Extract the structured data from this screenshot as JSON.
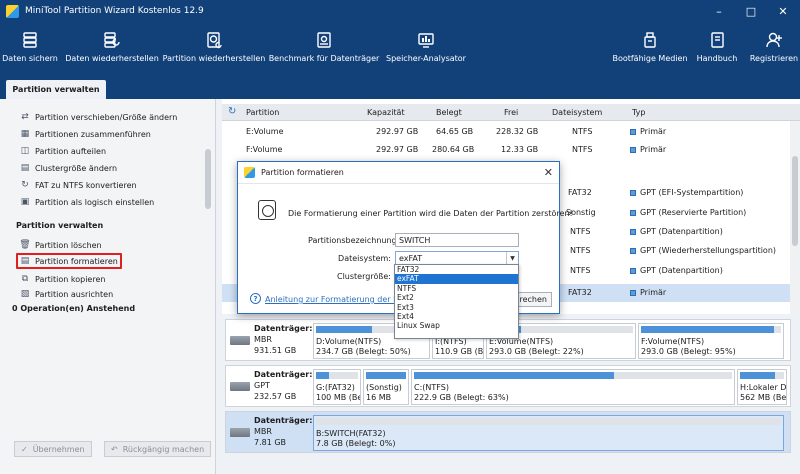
{
  "window": {
    "title": "MiniTool Partition Wizard Kostenlos 12.9"
  },
  "toolbar": {
    "items": [
      {
        "label": "Daten sichern",
        "icon": "data-backup-icon"
      },
      {
        "label": "Daten wiederherstellen",
        "icon": "data-recovery-icon"
      },
      {
        "label": "Partition wiederherstellen",
        "icon": "partition-recovery-icon"
      },
      {
        "label": "Benchmark für Datenträger",
        "icon": "disk-benchmark-icon"
      },
      {
        "label": "Speicher-Analysator",
        "icon": "space-analyzer-icon"
      },
      {
        "label": "Bootfähige Medien",
        "icon": "bootable-media-icon"
      },
      {
        "label": "Handbuch",
        "icon": "manual-icon"
      },
      {
        "label": "Registrieren",
        "icon": "register-icon"
      }
    ]
  },
  "tab": {
    "label": "Partition verwalten"
  },
  "sidebar": {
    "items_top": [
      "Partition verschieben/Größe ändern",
      "Partitionen zusammenführen",
      "Partition aufteilen",
      "Clustergröße ändern",
      "FAT zu NTFS konvertieren",
      "Partition als logisch einstellen"
    ],
    "section_title": "Partition verwalten",
    "items_manage": [
      "Partition löschen",
      "Partition formatieren",
      "Partition kopieren",
      "Partition ausrichten"
    ],
    "pending": "0 Operation(en) Anstehend",
    "apply": "Übernehmen",
    "undo": "Rückgängig machen"
  },
  "table": {
    "headers": [
      "Partition",
      "Kapazität",
      "Belegt",
      "Frei",
      "Dateisystem",
      "Typ"
    ],
    "rows": [
      [
        "E:Volume",
        "292.97 GB",
        "64.65 GB",
        "228.32 GB",
        "NTFS",
        "Primär"
      ],
      [
        "F:Volume",
        "292.97 GB",
        "280.64 GB",
        "12.33 GB",
        "NTFS",
        "Primär"
      ],
      [
        "",
        "",
        "",
        "",
        "FAT32",
        "GPT (EFI-Systempartition)"
      ],
      [
        "",
        "",
        "",
        "",
        "Sonstig",
        "GPT (Reservierte Partition)"
      ],
      [
        "",
        "",
        "",
        "",
        "NTFS",
        "GPT (Datenpartition)"
      ],
      [
        "",
        "",
        "",
        "",
        "NTFS",
        "GPT (Wiederherstellungspartition)"
      ],
      [
        "",
        "",
        "",
        "",
        "NTFS",
        "GPT (Datenpartition)"
      ],
      [
        "",
        "",
        "",
        "",
        "FAT32",
        "Primär"
      ]
    ]
  },
  "disks": [
    {
      "name": "Datenträger:1",
      "type": "MBR",
      "size": "931.51 GB",
      "parts": [
        {
          "l1": "D:Volume(NTFS)",
          "l2": "234.7 GB (Belegt: 50%)",
          "used": 0.5
        },
        {
          "l1": "I:(NTFS)",
          "l2": "110.9 GB (Belegt",
          "used": 0.05
        },
        {
          "l1": "E:Volume(NTFS)",
          "l2": "293.0 GB (Belegt: 22%)",
          "used": 0.22
        },
        {
          "l1": "F:Volume(NTFS)",
          "l2": "293.0 GB (Belegt: 95%)",
          "used": 0.95
        }
      ]
    },
    {
      "name": "Datenträger:2",
      "type": "GPT",
      "size": "232.57 GB",
      "parts": [
        {
          "l1": "G:(FAT32)",
          "l2": "100 MB (Belegt:",
          "used": 0.3
        },
        {
          "l1": "(Sonstig)",
          "l2": "16 MB",
          "used": 1.0
        },
        {
          "l1": "C:(NTFS)",
          "l2": "222.9 GB (Belegt: 63%)",
          "used": 0.63
        },
        {
          "l1": "H:Lokaler D",
          "l2": "562 MB (Be",
          "used": 0.8
        }
      ]
    },
    {
      "name": "Datenträger:3",
      "type": "MBR",
      "size": "7.81 GB",
      "parts": [
        {
          "l1": "B:SWITCH(FAT32)",
          "l2": "7.8 GB (Belegt: 0%)",
          "used": 0.0
        }
      ]
    }
  ],
  "dialog": {
    "title": "Partition formatieren",
    "warning": "Die Formatierung einer Partition wird die Daten der Partition zerstören!",
    "label_name": "Partitionsbezeichnung:",
    "value_name": "SWITCH",
    "label_fs": "Dateisystem:",
    "value_fs": "exFAT",
    "label_cluster": "Clustergröße:",
    "help_link": "Anleitung zur Formatierung der Partition",
    "cancel_partial": "brechen",
    "fs_options": [
      "FAT32",
      "exFAT",
      "NTFS",
      "Ext2",
      "Ext3",
      "Ext4",
      "Linux Swap"
    ],
    "fs_selected_index": 1
  },
  "colors": {
    "titlebar": "#12417a",
    "accent": "#1f73d1",
    "highlight_red": "#e0201e"
  }
}
